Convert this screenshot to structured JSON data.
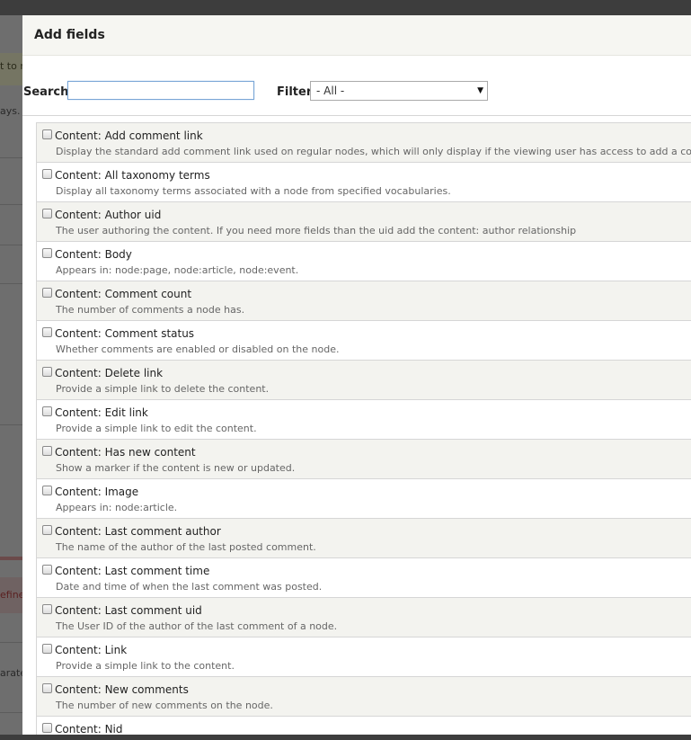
{
  "background": {
    "fragments": [
      "t to n",
      "ays.",
      "efined",
      "arate"
    ]
  },
  "dialog": {
    "title": "Add fields",
    "search_label": "Search",
    "search_value": "",
    "filter_label": "Filter",
    "filter_value": "- All -"
  },
  "fields": [
    {
      "label": "Content: Add comment link",
      "desc": "Display the standard add comment link used on regular nodes, which will only display if the viewing user has access to add a comment."
    },
    {
      "label": "Content: All taxonomy terms",
      "desc": "Display all taxonomy terms associated with a node from specified vocabularies."
    },
    {
      "label": "Content: Author uid",
      "desc": "The user authoring the content. If you need more fields than the uid add the content: author relationship"
    },
    {
      "label": "Content: Body",
      "desc": "Appears in: node:page, node:article, node:event."
    },
    {
      "label": "Content: Comment count",
      "desc": "The number of comments a node has."
    },
    {
      "label": "Content: Comment status",
      "desc": "Whether comments are enabled or disabled on the node."
    },
    {
      "label": "Content: Delete link",
      "desc": "Provide a simple link to delete the content."
    },
    {
      "label": "Content: Edit link",
      "desc": "Provide a simple link to edit the content."
    },
    {
      "label": "Content: Has new content",
      "desc": "Show a marker if the content is new or updated."
    },
    {
      "label": "Content: Image",
      "desc": "Appears in: node:article."
    },
    {
      "label": "Content: Last comment author",
      "desc": "The name of the author of the last posted comment."
    },
    {
      "label": "Content: Last comment time",
      "desc": "Date and time of when the last comment was posted."
    },
    {
      "label": "Content: Last comment uid",
      "desc": "The User ID of the author of the last comment of a node."
    },
    {
      "label": "Content: Link",
      "desc": "Provide a simple link to the content."
    },
    {
      "label": "Content: New comments",
      "desc": "The number of new comments on the node."
    },
    {
      "label": "Content: Nid",
      "desc": ""
    }
  ]
}
